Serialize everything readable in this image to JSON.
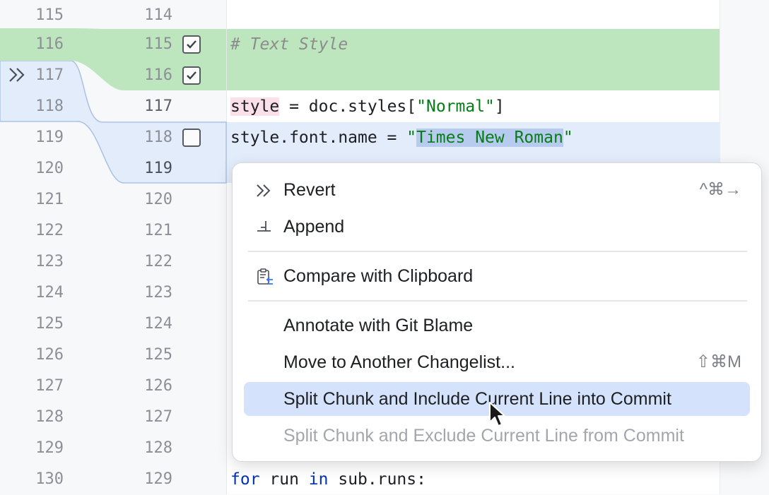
{
  "gutter": {
    "left_line_numbers": [
      "115",
      "116",
      "117",
      "118",
      "119",
      "120",
      "121",
      "122",
      "123",
      "124",
      "125",
      "126",
      "127",
      "128",
      "129",
      "130"
    ],
    "right_line_numbers": [
      "114",
      "115",
      "116",
      "117",
      "118",
      "119",
      "120",
      "121",
      "122",
      "123",
      "124",
      "125",
      "126",
      "127",
      "128",
      "129"
    ],
    "checkboxes": [
      {
        "line": "115",
        "checked": true
      },
      {
        "line": "116",
        "checked": true
      },
      {
        "line": "118",
        "checked": false
      }
    ]
  },
  "code": {
    "line1": "# Text Style",
    "line3_var": "style",
    "line3_rest": " = doc.styles[",
    "line3_str": "\"Normal\"",
    "line3_end": "]",
    "line4_pre": "style.font.name = ",
    "line4_q1": "\"",
    "line4_sel": "Times New Roman",
    "line4_q2": "\"",
    "last_kw1": "for",
    "last_mid": " run ",
    "last_kw2": "in",
    "last_end": " sub.runs:"
  },
  "menu": {
    "items": [
      {
        "label": "Revert",
        "shortcut": "^⌘→",
        "icon": "revert-icon"
      },
      {
        "label": "Append",
        "shortcut": "",
        "icon": "append-icon"
      },
      {
        "label": "Compare with Clipboard",
        "shortcut": "",
        "icon": "clipboard-compare-icon"
      },
      {
        "label": "Annotate with Git Blame",
        "shortcut": ""
      },
      {
        "label": "Move to Another Changelist...",
        "shortcut": "⇧⌘M"
      },
      {
        "label": "Split Chunk and Include Current Line into Commit",
        "shortcut": "",
        "highlighted": true
      },
      {
        "label": "Split Chunk and Exclude Current Line from Commit",
        "shortcut": "",
        "disabled": true
      }
    ]
  },
  "colors": {
    "added_green": "#bee6be",
    "modified_blue": "#e3ecfa",
    "menu_highlight": "#d4e2fb",
    "string_green": "#067d17",
    "keyword_blue": "#0033b3"
  }
}
